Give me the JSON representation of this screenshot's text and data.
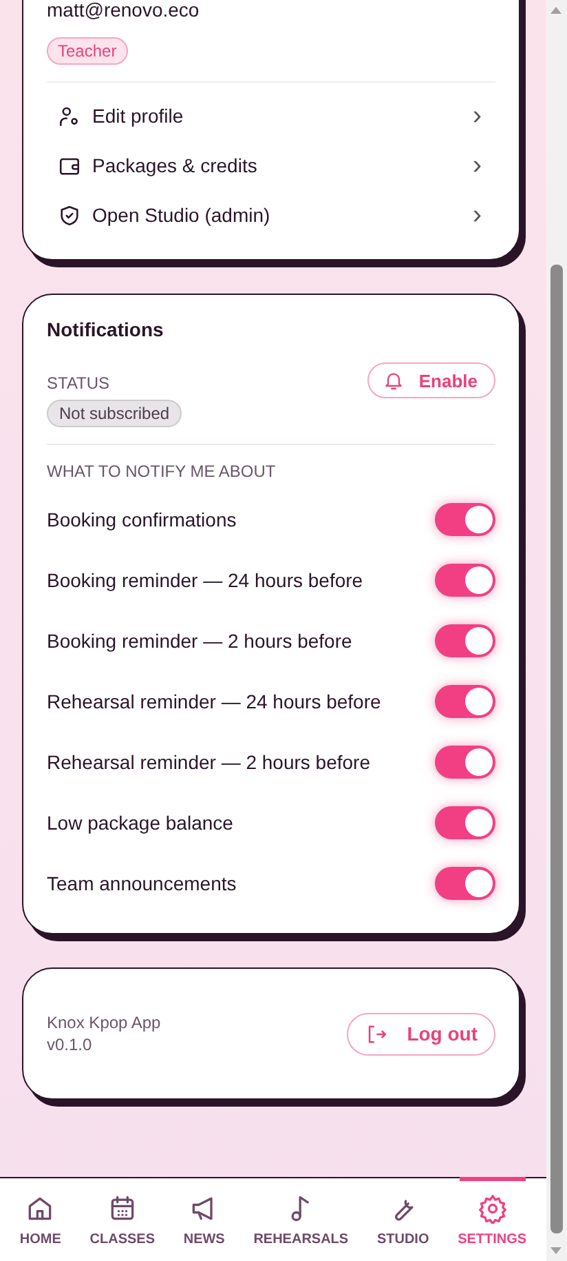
{
  "profile": {
    "email": "matt@renovo.eco",
    "role": "Teacher",
    "menu": [
      {
        "kind": "profile",
        "label": "Edit profile",
        "chevron": "›"
      },
      {
        "kind": "wallet",
        "label": "Packages & credits",
        "chevron": "›"
      },
      {
        "kind": "shield",
        "label": "Open Studio (admin)",
        "chevron": "›"
      }
    ]
  },
  "notifications": {
    "title": "Notifications",
    "status_label": "STATUS",
    "status": "Not subscribed",
    "enable_button": "Enable",
    "section_label": "WHAT TO NOTIFY ME ABOUT",
    "items": [
      {
        "label": "Booking confirmations",
        "on": true
      },
      {
        "label": "Booking reminder — 24 hours before",
        "on": true
      },
      {
        "label": "Booking reminder — 2 hours before",
        "on": true
      },
      {
        "label": "Rehearsal reminder — 24 hours before",
        "on": true
      },
      {
        "label": "Rehearsal reminder — 2 hours before",
        "on": true
      },
      {
        "label": "Low package balance",
        "on": true
      },
      {
        "label": "Team announcements",
        "on": true
      }
    ]
  },
  "app": {
    "name": "Knox Kpop App",
    "version": "v0.1.0",
    "logout_button": "Log out"
  },
  "nav": [
    {
      "kind": "home",
      "label": "HOME",
      "selected": false
    },
    {
      "kind": "calendar",
      "label": "CLASSES",
      "selected": false
    },
    {
      "kind": "megaphone",
      "label": "NEWS",
      "selected": false
    },
    {
      "kind": "note",
      "label": "REHEARSALS",
      "selected": false
    },
    {
      "kind": "wrench",
      "label": "STUDIO",
      "selected": false
    },
    {
      "kind": "gear",
      "label": "SETTINGS",
      "selected": true
    }
  ]
}
